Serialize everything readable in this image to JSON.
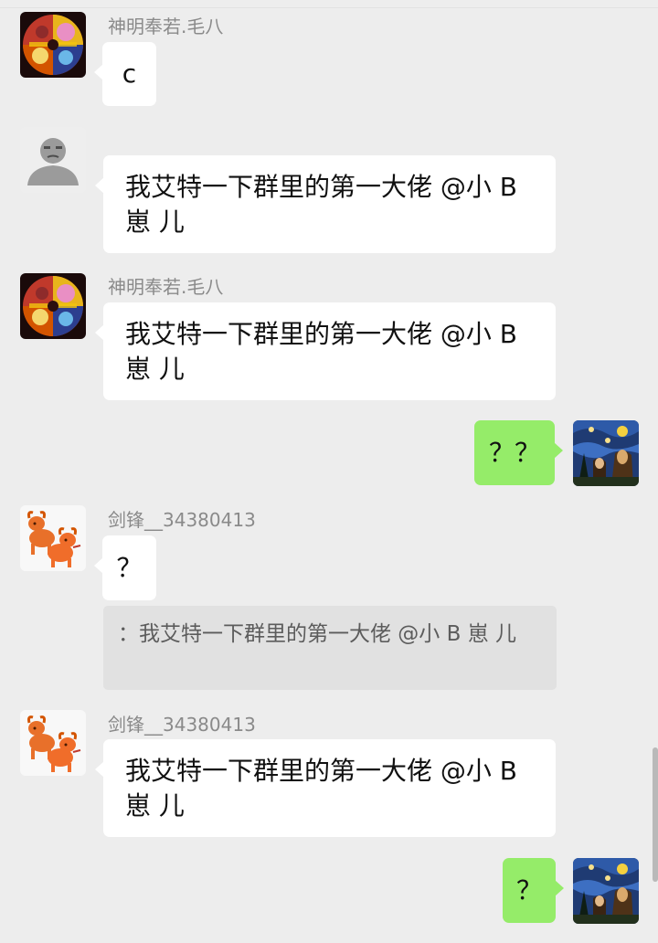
{
  "messages": [
    {
      "sender": "神明奉若.毛八",
      "text": "c",
      "avatar": "chaos-collage-avatar"
    },
    {
      "sender": "",
      "text": "我艾特一下群里的第一大佬 @小 B 崽 儿",
      "avatar": "default-gray-avatar"
    },
    {
      "sender": "神明奉若.毛八",
      "text": "我艾特一下群里的第一大佬 @小 B 崽 儿",
      "avatar": "chaos-collage-avatar"
    },
    {
      "sender": "me",
      "text": "？？",
      "avatar": "starry-night-mona-lisa-avatar"
    },
    {
      "sender": "剑锋__34380413",
      "text": "？",
      "avatar": "orange-ox-avatar",
      "quote": "：我艾特一下群里的第一大佬 @小 B 崽 儿"
    },
    {
      "sender": "剑锋__34380413",
      "text": "我艾特一下群里的第一大佬 @小 B 崽 儿",
      "avatar": "orange-ox-avatar"
    },
    {
      "sender": "me",
      "text": "？",
      "avatar": "starry-night-mona-lisa-avatar"
    }
  ],
  "colors": {
    "background": "#ededed",
    "incoming_bubble": "#ffffff",
    "outgoing_bubble": "#95ec69",
    "quote_bg": "#e1e1e1",
    "sender_name": "#8a8a8a"
  }
}
